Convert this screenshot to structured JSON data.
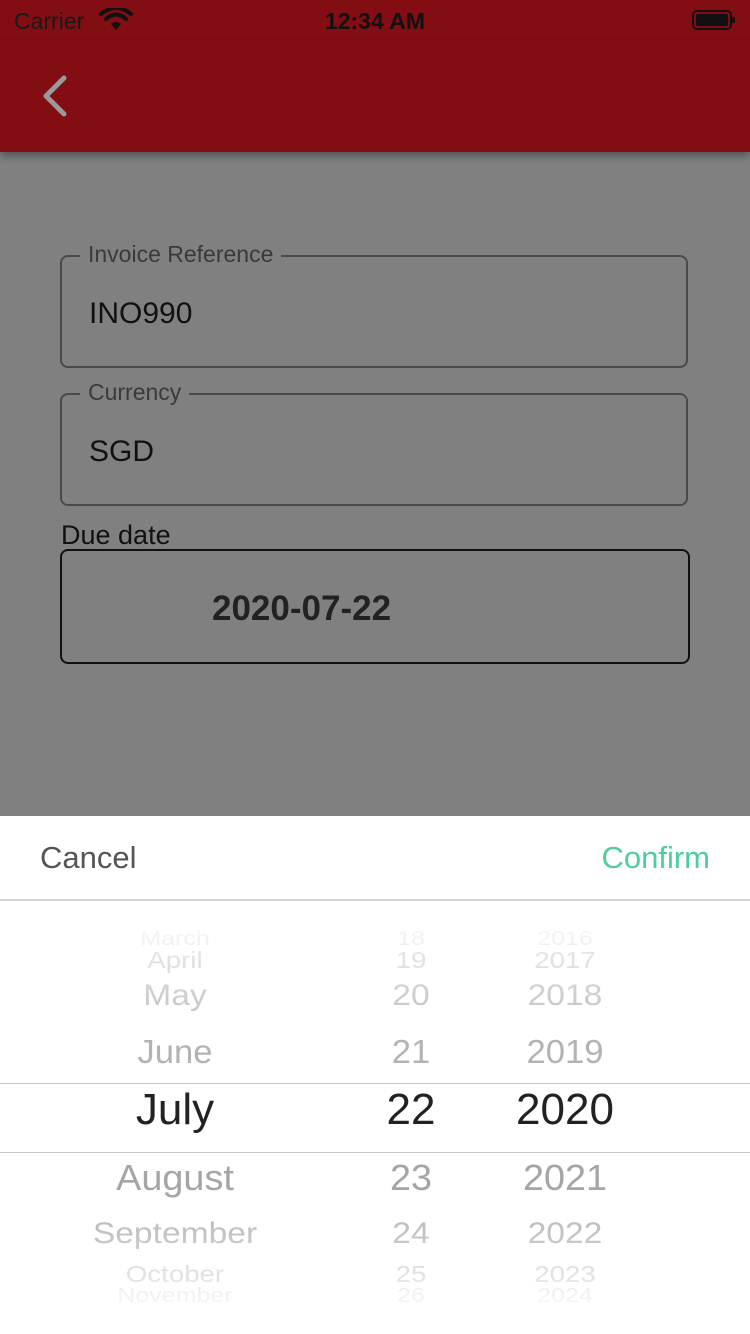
{
  "status_bar": {
    "carrier": "Carrier",
    "time": "12:34 AM"
  },
  "navbar": {
    "back_icon": "chevron-left-icon",
    "color": "#820e14"
  },
  "form": {
    "invoice_reference": {
      "label": "Invoice Reference",
      "value": "INO990"
    },
    "currency": {
      "label": "Currency",
      "value": "SGD"
    },
    "due_date": {
      "label": "Due date",
      "value": "2020-07-22"
    }
  },
  "picker": {
    "cancel_label": "Cancel",
    "confirm_label": "Confirm",
    "confirm_color": "#4ccf9b",
    "months": [
      "March",
      "April",
      "May",
      "June",
      "July",
      "August",
      "September",
      "October",
      "November"
    ],
    "days": [
      "18",
      "19",
      "20",
      "21",
      "22",
      "23",
      "24",
      "25",
      "26"
    ],
    "years": [
      "2016",
      "2017",
      "2018",
      "2019",
      "2020",
      "2021",
      "2022",
      "2023",
      "2024"
    ],
    "selected": {
      "month": "July",
      "day": "22",
      "year": "2020"
    }
  }
}
